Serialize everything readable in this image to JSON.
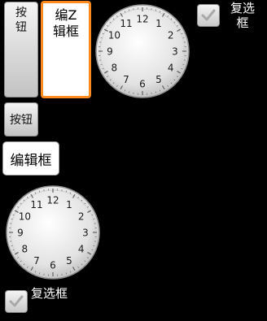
{
  "tall_button": {
    "label": "按\n钮"
  },
  "tall_edit": {
    "text": "编Z\n辑框"
  },
  "top_checkbox": {
    "label": "复选\n框",
    "checked": true
  },
  "small_button": {
    "label": "按钮"
  },
  "small_edit": {
    "text": "编辑框"
  },
  "bottom_checkbox": {
    "label": "复选框",
    "checked": true
  },
  "clock_numerals": [
    "12",
    "1",
    "2",
    "3",
    "4",
    "5",
    "6",
    "7",
    "8",
    "9",
    "10",
    "11"
  ],
  "colors": {
    "background": "#000000",
    "focus_border": "#ff8a1f",
    "check": "#a9a9a9"
  }
}
